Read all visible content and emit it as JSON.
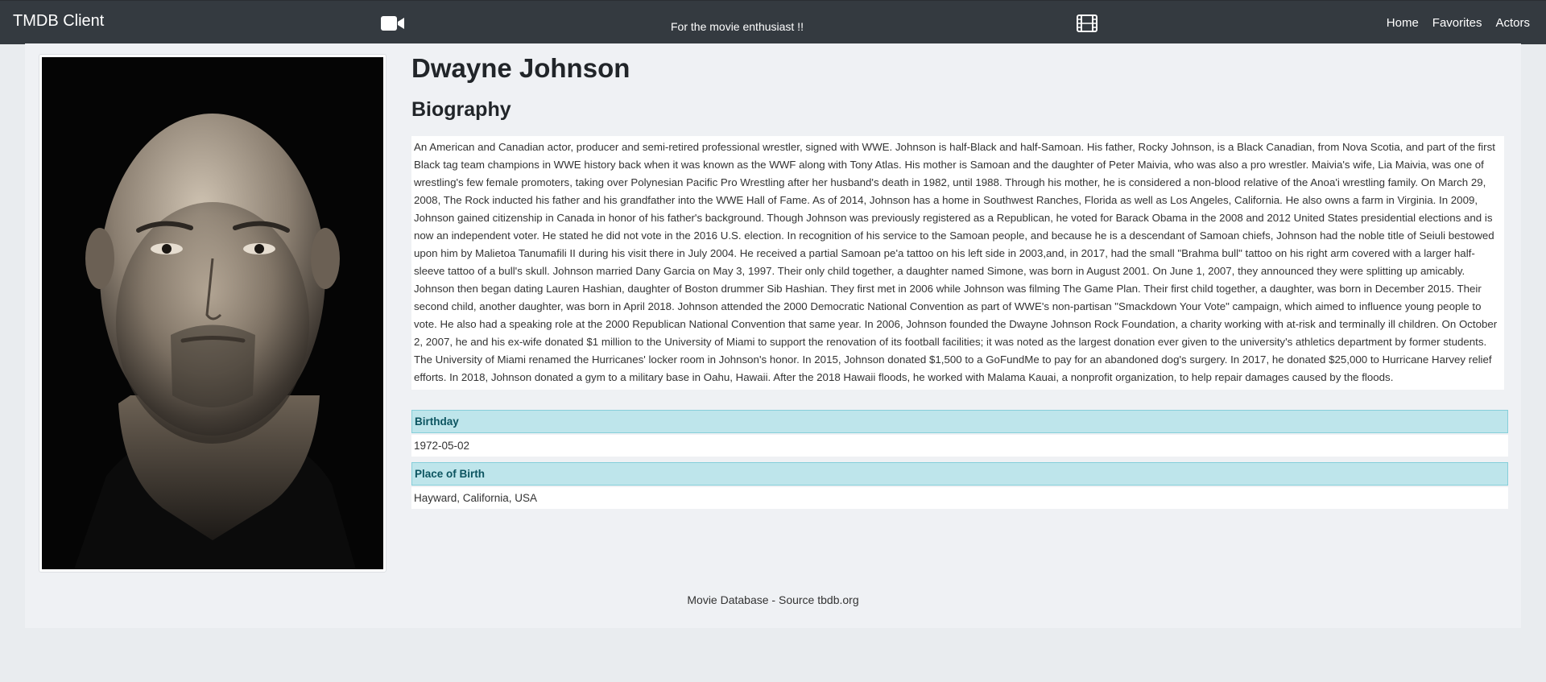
{
  "navbar": {
    "brand": "TMDB Client",
    "camera_icon": "video-camera-icon",
    "tagline": "For the movie enthusiast !!",
    "film_icon": "film-icon",
    "links": [
      {
        "label": "Home"
      },
      {
        "label": "Favorites"
      },
      {
        "label": "Actors"
      }
    ]
  },
  "actor": {
    "name": "Dwayne Johnson",
    "biography_heading": "Biography",
    "biography": "An American and Canadian actor, producer and semi-retired professional wrestler, signed with WWE. Johnson is half-Black and half-Samoan. His father, Rocky Johnson, is a Black Canadian, from Nova Scotia, and part of the first Black tag team champions in WWE history back when it was known as the WWF along with Tony Atlas. His mother is Samoan and the daughter of Peter Maivia, who was also a pro wrestler. Maivia's wife, Lia Maivia, was one of wrestling's few female promoters, taking over Polynesian Pacific Pro Wrestling after her husband's death in 1982, until 1988. Through his mother, he is considered a non-blood relative of the Anoa'i wrestling family. On March 29, 2008, The Rock inducted his father and his grandfather into the WWE Hall of Fame. As of 2014, Johnson has a home in Southwest Ranches, Florida as well as Los Angeles, California. He also owns a farm in Virginia. In 2009, Johnson gained citizenship in Canada in honor of his father's background. Though Johnson was previously registered as a Republican, he voted for Barack Obama in the 2008 and 2012 United States presidential elections and is now an independent voter. He stated he did not vote in the 2016 U.S. election. In recognition of his service to the Samoan people, and because he is a descendant of Samoan chiefs, Johnson had the noble title of Seiuli bestowed upon him by Malietoa Tanumafili II during his visit there in July 2004. He received a partial Samoan pe'a tattoo on his left side in 2003,and, in 2017, had the small \"Brahma bull\" tattoo on his right arm covered with a larger half-sleeve tattoo of a bull's skull. Johnson married Dany Garcia on May 3, 1997. Their only child together, a daughter named Simone, was born in August 2001. On June 1, 2007, they announced they were splitting up amicably. Johnson then began dating Lauren Hashian, daughter of Boston drummer Sib Hashian. They first met in 2006 while Johnson was filming The Game Plan. Their first child together, a daughter, was born in December 2015. Their second child, another daughter, was born in April 2018. Johnson attended the 2000 Democratic National Convention as part of WWE's non-partisan \"Smackdown Your Vote\" campaign, which aimed to influence young people to vote. He also had a speaking role at the 2000 Republican National Convention that same year. In 2006, Johnson founded the Dwayne Johnson Rock Foundation, a charity working with at-risk and terminally ill children. On October 2, 2007, he and his ex-wife donated $1 million to the University of Miami to support the renovation of its football facilities; it was noted as the largest donation ever given to the university's athletics department by former students. The University of Miami renamed the Hurricanes' locker room in Johnson's honor. In 2015, Johnson donated $1,500 to a GoFundMe to pay for an abandoned dog's surgery. In 2017, he donated $25,000 to Hurricane Harvey relief efforts. In 2018, Johnson donated a gym to a military base in Oahu, Hawaii. After the 2018 Hawaii floods, he worked with Malama Kauai, a nonprofit organization, to help repair damages caused by the floods.",
    "birthday_label": "Birthday",
    "birthday": "1972-05-02",
    "birthplace_label": "Place of Birth",
    "birthplace": "Hayward, California, USA"
  },
  "footer": {
    "text": "Movie Database - Source tbdb.org"
  }
}
